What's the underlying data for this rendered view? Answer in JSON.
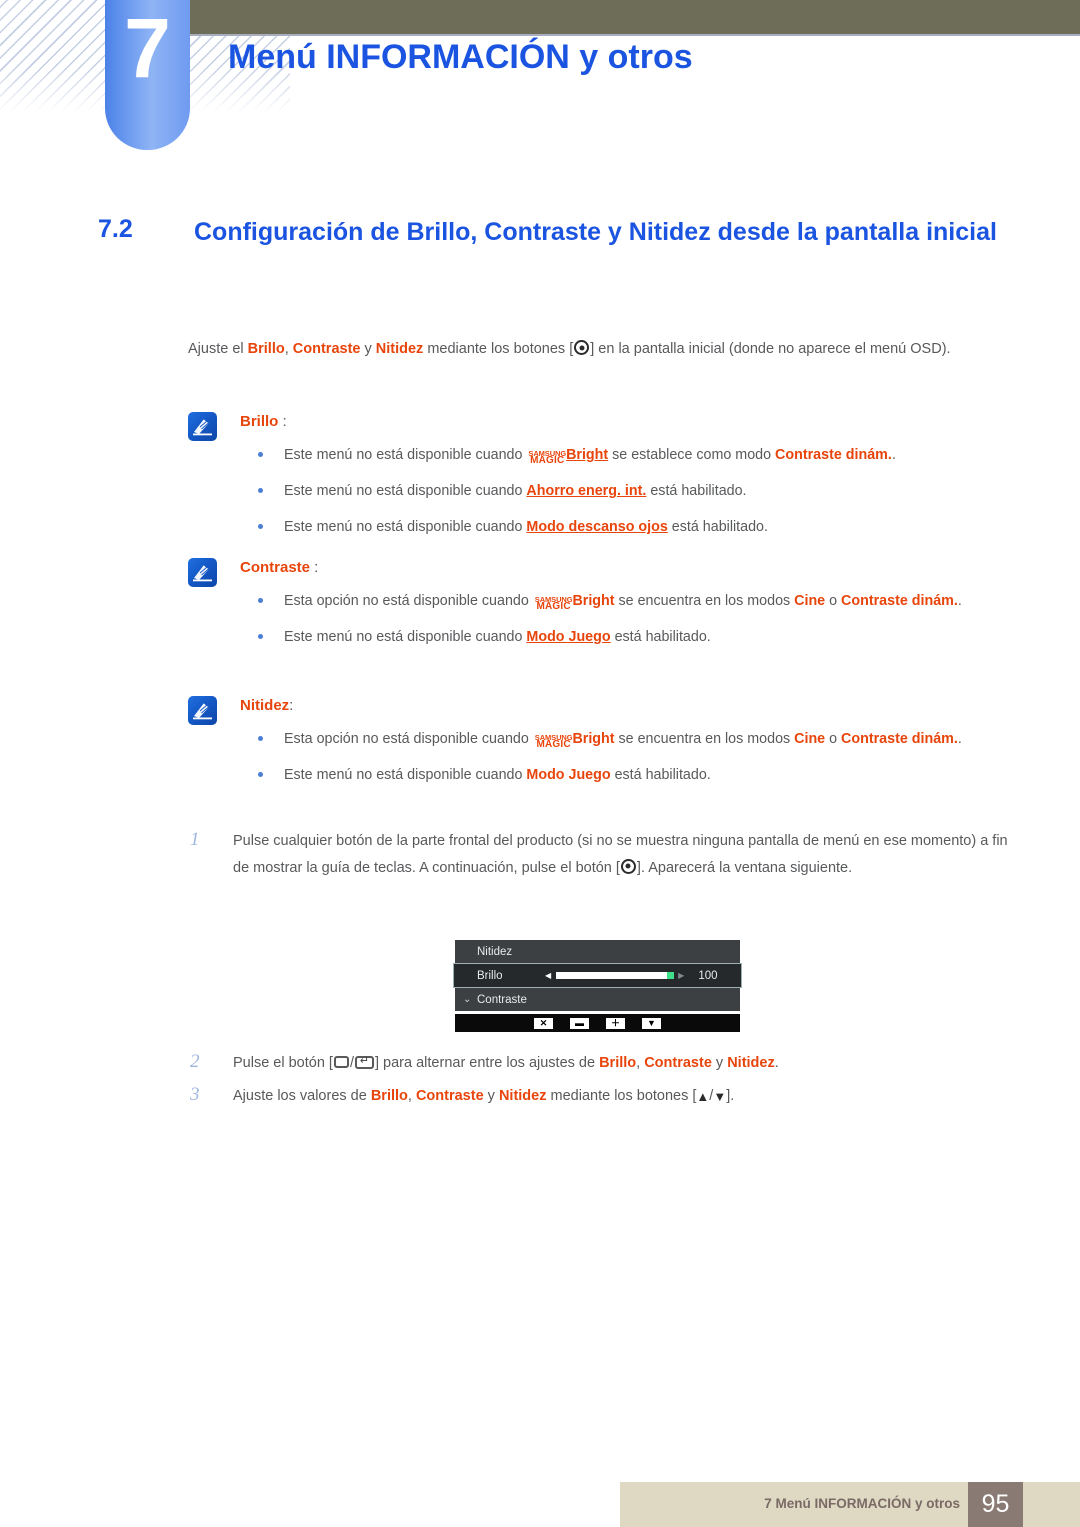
{
  "header": {
    "chapter_number": "7",
    "chapter_title": "Menú INFORMACIÓN y otros"
  },
  "section": {
    "number": "7.2",
    "title": "Configuración de Brillo, Contraste y Nitidez desde la pantalla inicial"
  },
  "intro": {
    "t1": "Ajuste el ",
    "brillo": "Brillo",
    "t2": ", ",
    "contraste": "Contraste",
    "t3": " y ",
    "nitidez": "Nitidez",
    "t4": " mediante los botones [",
    "t5": "] en la pantalla inicial (donde no aparece el menú OSD)."
  },
  "notes": [
    {
      "icon": "note-pen-icon",
      "title": "Brillo",
      "colon": " :",
      "bullets": [
        {
          "pre": "Este menú no está disponible cuando ",
          "logo_top": "SAMSUNG",
          "logo_bottom": "MAGIC",
          "bright": "Bright",
          "mid": " se establece como modo ",
          "target": "Contraste dinám.",
          "post": ".",
          "target_underlined": false
        },
        {
          "pre": "Este menú no está disponible cuando ",
          "target": "Ahorro energ. int.",
          "post": " está habilitado.",
          "target_underlined": true
        },
        {
          "pre": "Este menú no está disponible cuando ",
          "target": "Modo descanso ojos",
          "post": " está habilitado.",
          "target_underlined": true
        }
      ]
    },
    {
      "icon": "note-pen-icon",
      "title": "Contraste",
      "colon": " :",
      "bullets": [
        {
          "pre": "Esta opción no está disponible cuando ",
          "logo_top": "SAMSUNG",
          "logo_bottom": "MAGIC",
          "bright": "Bright",
          "mid": " se encuentra en los modos ",
          "target": "Cine",
          "mid2": " o ",
          "target2": "Contraste dinám.",
          "post": ".",
          "target_underlined": false
        },
        {
          "pre": "Este menú no está disponible cuando ",
          "target": "Modo Juego",
          "post": " está habilitado.",
          "target_underlined": true
        }
      ]
    },
    {
      "icon": "note-pen-icon",
      "title": "Nitidez",
      "colon": ":",
      "bullets": [
        {
          "pre": "Esta opción no está disponible cuando ",
          "logo_top": "SAMSUNG",
          "logo_bottom": "MAGIC",
          "bright": "Bright",
          "mid": " se encuentra en los modos ",
          "target": "Cine",
          "mid2": " o ",
          "target2": "Contraste dinám.",
          "post": ".",
          "target_underlined": false
        },
        {
          "pre": "Este menú no está disponible cuando ",
          "target": "Modo Juego",
          "post": " está habilitado.",
          "target_underlined": false
        }
      ]
    }
  ],
  "steps": {
    "one": {
      "num": "1",
      "a": "Pulse cualquier botón de la parte frontal del producto (si no se muestra ninguna pantalla de menú en ese momento) a fin de mostrar la guía de teclas. A continuación, pulse el botón [",
      "b": "]. Aparecerá la ventana siguiente."
    },
    "two": {
      "num": "2",
      "a": "Pulse el botón [",
      "slash": "/",
      "b": "] para alternar entre los ajustes de ",
      "brillo": "Brillo",
      "c": ", ",
      "contraste": "Contraste",
      "d": " y ",
      "nitidez": "Nitidez",
      "e": "."
    },
    "three": {
      "num": "3",
      "a": "Ajuste los valores de ",
      "brillo": "Brillo",
      "b": ", ",
      "contraste": "Contraste",
      "c": " y ",
      "nitidez": "Nitidez",
      "d": " mediante los botones [",
      "up": "▲",
      "slash": "/",
      "down": "▼",
      "e": "]."
    }
  },
  "osd": {
    "rows": [
      {
        "label": "Nitidez",
        "selected": false,
        "chevron": false,
        "has_slider": false,
        "value": ""
      },
      {
        "label": "Brillo",
        "selected": true,
        "chevron": false,
        "has_slider": true,
        "value": "100"
      },
      {
        "label": "Contraste",
        "selected": false,
        "chevron": true,
        "has_slider": false,
        "value": ""
      }
    ],
    "slider_fill_percent": 100,
    "keys": [
      {
        "name": "close-key",
        "glyph": "✕"
      },
      {
        "name": "minus-key",
        "glyph": "▬"
      },
      {
        "name": "plus-key",
        "glyph": "＋"
      },
      {
        "name": "down-key",
        "glyph": "▼"
      }
    ],
    "colors": {
      "panel_bg": "#3c4043",
      "selected_bg": "#26292b",
      "knob": "#3ee08a",
      "keybar_bg": "#0a0a0a"
    }
  },
  "footer": {
    "text": "7 Menú INFORMACIÓN y otros",
    "page": "95"
  },
  "theme": {
    "accent_blue": "#1a54e0",
    "highlight_orange": "#e8450c",
    "olive": "#6e6d58",
    "footer_bar": "#dfd9c3",
    "footer_page_box": "#8a7a74"
  }
}
